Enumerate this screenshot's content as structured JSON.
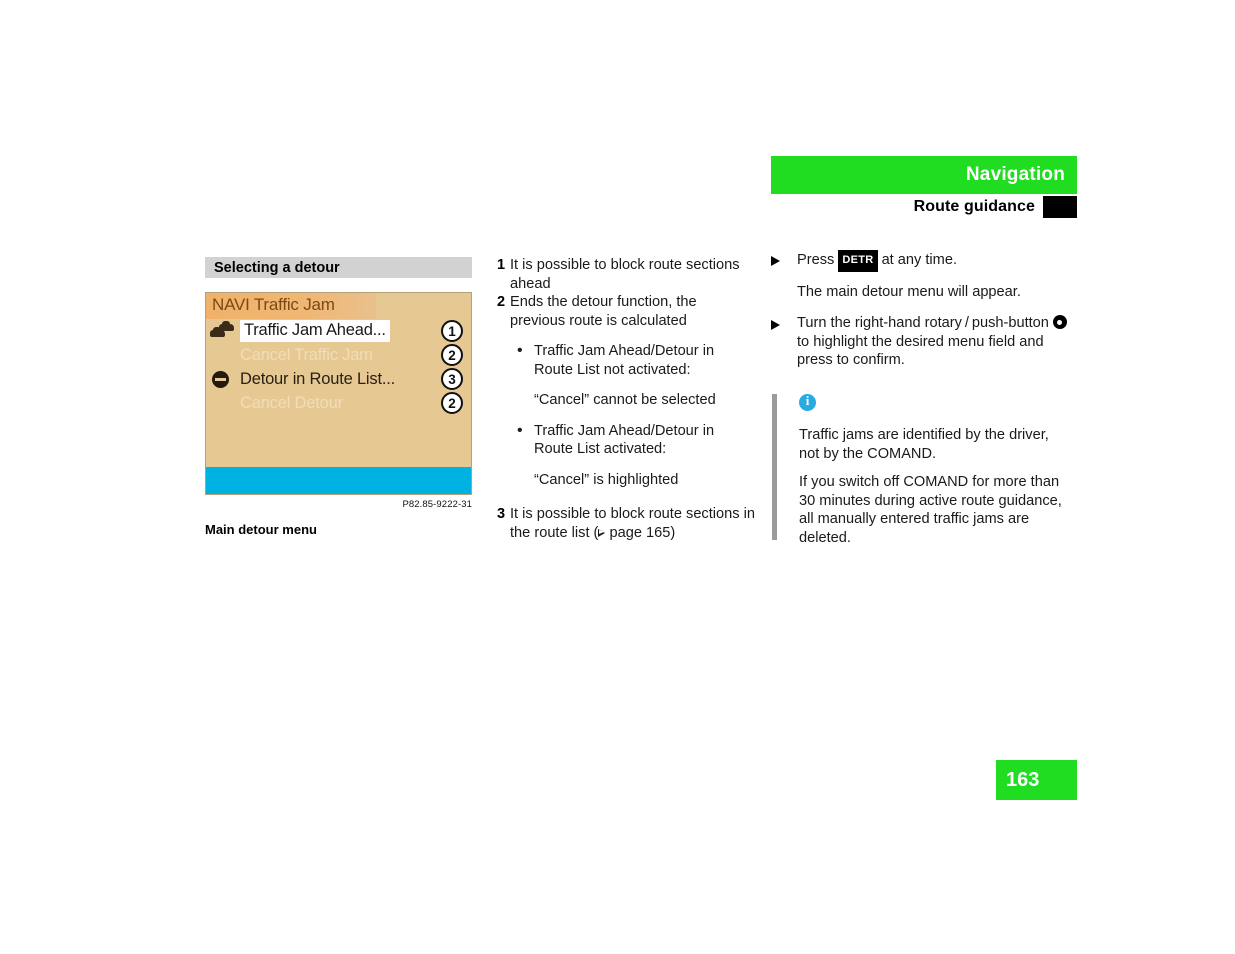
{
  "header": {
    "title": "Navigation",
    "subtitle": "Route guidance",
    "band_color": "#21dd21",
    "tab_color": "#000000"
  },
  "left_column": {
    "section_heading": "Selecting a detour",
    "nav_screen": {
      "title": "NAVI Traffic Jam",
      "background_color": "#e6c893",
      "titlebar_color": "#f0b26a",
      "bottom_bar_color": "#00b2e2",
      "rows": [
        {
          "icon": "traffic-jam-icon",
          "label": "Traffic Jam Ahead...",
          "state": "highlighted",
          "callout": "1"
        },
        {
          "icon": "none",
          "label": "Cancel Traffic Jam",
          "state": "disabled",
          "callout": "2"
        },
        {
          "icon": "no-entry-icon",
          "label": "Detour in Route List...",
          "state": "enabled",
          "callout": "3"
        },
        {
          "icon": "none",
          "label": "Cancel Detour",
          "state": "disabled",
          "callout": "2"
        }
      ]
    },
    "photo_credit": "P82.85-9222-31",
    "figure_caption": "Main detour menu"
  },
  "middle_column": {
    "items": [
      {
        "marker": "1",
        "text": "It is possible to block route sections ahead"
      },
      {
        "marker": "2",
        "text": "Ends the detour function, the previous route is calculated"
      }
    ],
    "bullets": [
      {
        "text": "Traffic Jam Ahead/Detour in Route List not activated:",
        "quote": "“Cancel” cannot be selected"
      },
      {
        "text": "Traffic Jam Ahead/Detour in Route List activated:",
        "quote": "“Cancel” is highlighted"
      }
    ],
    "item3": {
      "marker": "3",
      "text_before": "It is possible to block route sections in the route list (",
      "page_ref": " page 165)"
    }
  },
  "right_column": {
    "step1": {
      "text_before": "Press ",
      "key_label": "DETR",
      "text_after": " at any time.",
      "follow_up": "The main detour menu will appear."
    },
    "step2": {
      "text_before": "Turn the right-hand rotary / push-button ",
      "text_after": " to highlight the desired menu field and press to confirm."
    },
    "note": {
      "icon": "info-icon",
      "rule_color": "#9b9b9b",
      "paragraphs": [
        "Traffic jams are identified by the driver, not by the COMAND.",
        "If you switch off COMAND for more than 30 minutes during active route guidance, all manually entered traffic jams are deleted."
      ]
    }
  },
  "page_number": "163"
}
